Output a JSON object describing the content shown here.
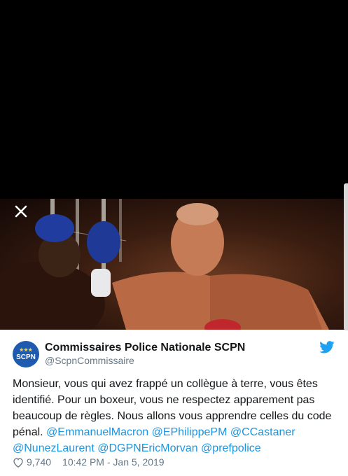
{
  "viewer": {
    "close_icon": "close-icon"
  },
  "tweet": {
    "author_name": "Commissaires Police Nationale SCPN",
    "author_handle": "@ScpnCommissaire",
    "avatar_text": "SCPN",
    "avatar_color": "#1d5ab0",
    "text_plain": "Monsieur, vous qui avez frappé un collègue à terre, vous êtes identifié. Pour un boxeur, vous ne respectez apparement pas beaucoup de règles. Nous allons vous apprendre celles du code pénal.",
    "mentions": [
      "@EmmanuelMacron",
      "@EPhilippePM",
      "@CCastaner",
      "@NunezLaurent",
      "@DGPNEricMorvan",
      "@prefpolice"
    ],
    "likes": "9,740",
    "timestamp": "10:42 PM - Jan 5, 2019",
    "mention_color": "#1b95e0",
    "brand_icon": "twitter-bird-icon",
    "brand_color": "#1da1f2"
  }
}
